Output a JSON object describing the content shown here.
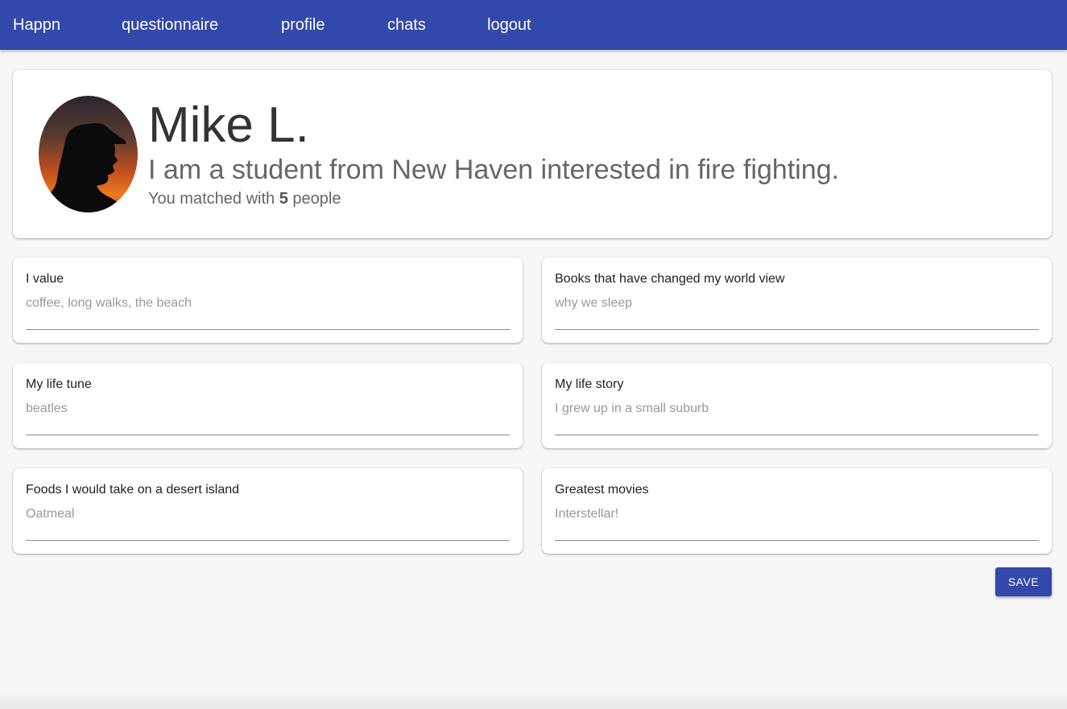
{
  "nav": {
    "brand": "Happn",
    "items": [
      {
        "label": "questionnaire"
      },
      {
        "label": "profile"
      },
      {
        "label": "chats"
      },
      {
        "label": "logout"
      }
    ],
    "color": "#3248ab"
  },
  "profile": {
    "name": "Mike L.",
    "bio": "I am a student from New Haven interested in fire fighting.",
    "matches_prefix": "You matched with",
    "matches_count": "5",
    "matches_suffix": "people",
    "avatar_icon": "user-silhouette-avatar"
  },
  "fields": [
    {
      "label": "I value",
      "value": "coffee, long walks, the beach"
    },
    {
      "label": "Books that have changed my world view",
      "value": "why we sleep"
    },
    {
      "label": "My life tune",
      "value": "beatles"
    },
    {
      "label": "My life story",
      "value": "I grew up in a small suburb"
    },
    {
      "label": "Foods I would take on a desert island",
      "value": "Oatmeal"
    },
    {
      "label": "Greatest movies",
      "value": "Interstellar!"
    }
  ],
  "actions": {
    "save_label": "SAVE"
  }
}
